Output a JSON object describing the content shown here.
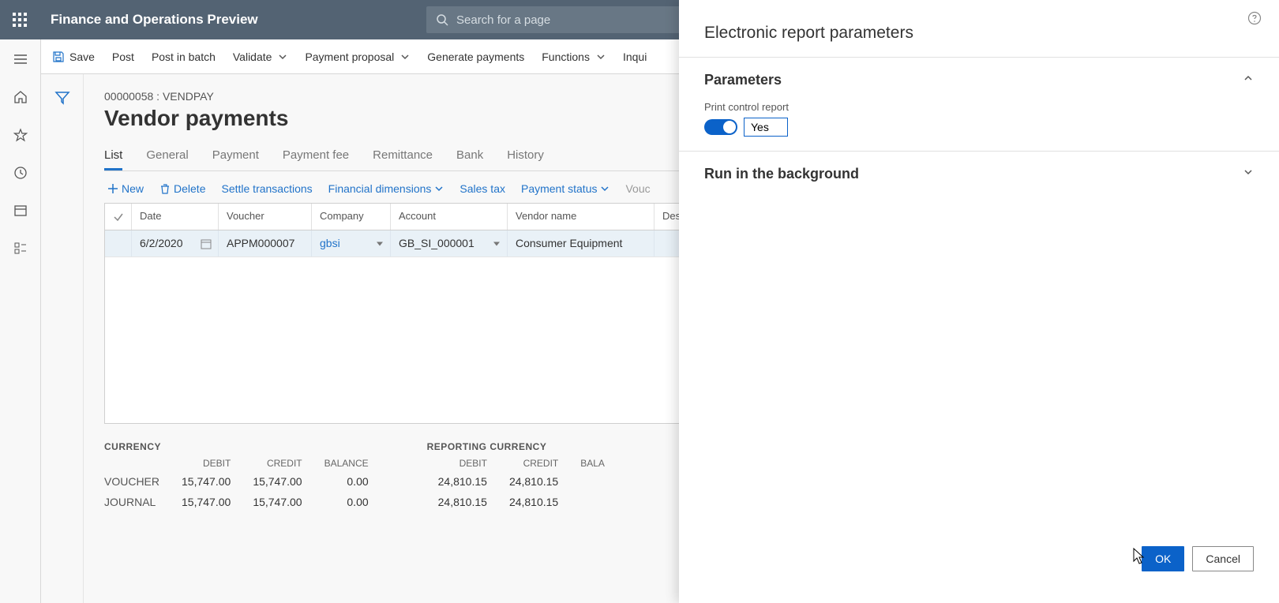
{
  "header": {
    "app_title": "Finance and Operations Preview",
    "search_placeholder": "Search for a page"
  },
  "action_bar": {
    "save": "Save",
    "post": "Post",
    "post_batch": "Post in batch",
    "validate": "Validate",
    "payment_proposal": "Payment proposal",
    "generate_payments": "Generate payments",
    "functions": "Functions",
    "inquiries": "Inqui"
  },
  "page": {
    "breadcrumb": "00000058 : VENDPAY",
    "title": "Vendor payments"
  },
  "tabs": [
    "List",
    "General",
    "Payment",
    "Payment fee",
    "Remittance",
    "Bank",
    "History"
  ],
  "grid_actions": {
    "new": "New",
    "delete": "Delete",
    "settle": "Settle transactions",
    "fin_dims": "Financial dimensions",
    "sales_tax": "Sales tax",
    "pay_status": "Payment status",
    "voucher": "Vouc"
  },
  "grid": {
    "columns": {
      "date": "Date",
      "voucher": "Voucher",
      "company": "Company",
      "account": "Account",
      "vendor": "Vendor name",
      "desc": "Des"
    },
    "rows": [
      {
        "date": "6/2/2020",
        "voucher": "APPM000007",
        "company": "gbsi",
        "account": "GB_SI_000001",
        "vendor": "Consumer Equipment",
        "desc": ""
      }
    ]
  },
  "totals": {
    "currency_title": "CURRENCY",
    "reporting_title": "REPORTING CURRENCY",
    "headers": {
      "debit": "DEBIT",
      "credit": "CREDIT",
      "balance": "BALANCE",
      "balance_cut": "BALA"
    },
    "rows": {
      "voucher_label": "VOUCHER",
      "journal_label": "JOURNAL",
      "currency": {
        "voucher": {
          "debit": "15,747.00",
          "credit": "15,747.00",
          "balance": "0.00"
        },
        "journal": {
          "debit": "15,747.00",
          "credit": "15,747.00",
          "balance": "0.00"
        }
      },
      "reporting": {
        "voucher": {
          "debit": "24,810.15",
          "credit": "24,810.15"
        },
        "journal": {
          "debit": "24,810.15",
          "credit": "24,810.15"
        }
      }
    }
  },
  "panel": {
    "title": "Electronic report parameters",
    "sections": {
      "parameters": "Parameters",
      "print_control_label": "Print control report",
      "print_control_value": "Yes",
      "run_bg": "Run in the background"
    },
    "footer": {
      "ok": "OK",
      "cancel": "Cancel"
    }
  }
}
